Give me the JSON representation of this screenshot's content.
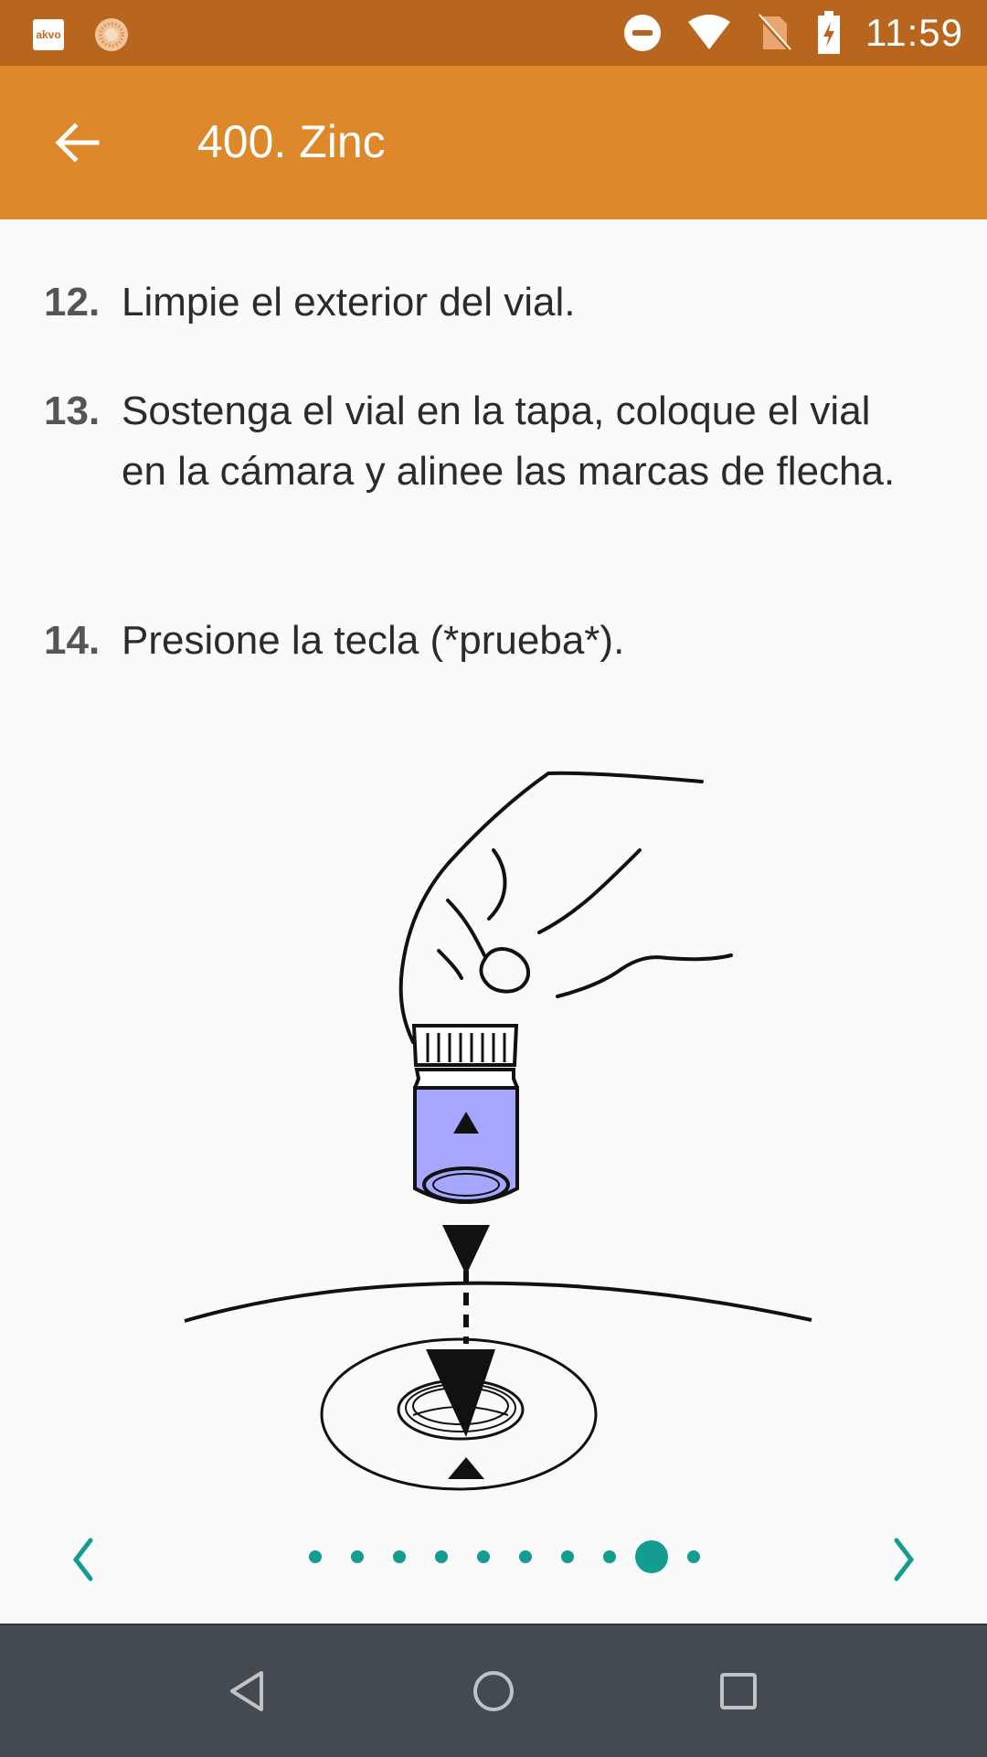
{
  "status_bar": {
    "app_icon_text": "akvo",
    "time": "11:59",
    "icons": [
      "akvo-icon",
      "sun-icon",
      "do-not-disturb-icon",
      "wifi-icon",
      "no-sim-icon",
      "battery-charging-icon"
    ]
  },
  "app_bar": {
    "title": "400. Zinc",
    "back_icon": "arrow-left-icon"
  },
  "steps": [
    {
      "number": "12.",
      "text": "Limpie el exterior del vial."
    },
    {
      "number": "13.",
      "text": "Sostenga el vial en la tapa, coloque el vial en la cámara y alinee las marcas de flecha."
    },
    {
      "number": "14.",
      "text": "Presione la tecla (*prueba*)."
    }
  ],
  "pager": {
    "total_pages": 10,
    "current_page": 9,
    "prev_icon": "chevron-left-icon",
    "next_icon": "chevron-right-icon",
    "accent_color": "#129c92"
  },
  "nav_bar": {
    "icons": [
      "back-triangle-icon",
      "home-circle-icon",
      "recents-square-icon"
    ]
  },
  "colors": {
    "status_bar": "#b8661e",
    "app_bar": "#dd882b",
    "vial_liquid": "#a6a6ff",
    "nav_bar": "#434a50"
  }
}
